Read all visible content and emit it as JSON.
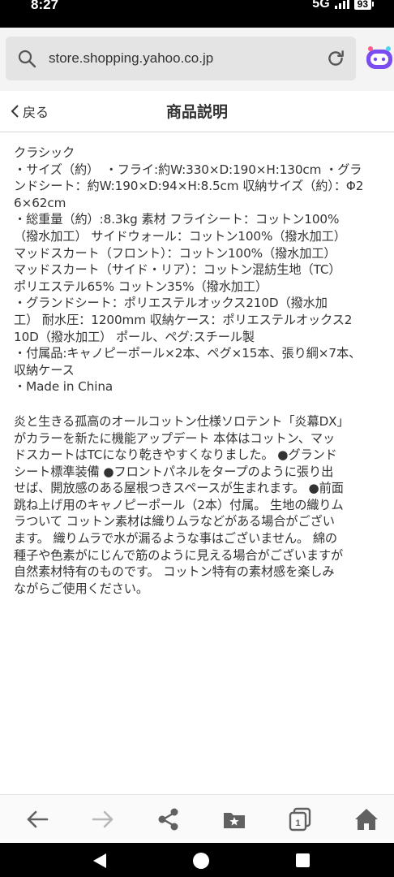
{
  "status_bar": {
    "time": "8:27",
    "network": "5G",
    "battery": "93"
  },
  "browser": {
    "url": "store.shopping.yahoo.co.jp"
  },
  "header": {
    "back_label": "戻る",
    "title": "商品説明"
  },
  "description": {
    "spec_lines": [
      "クラシック",
      "・サイズ（約）　・フライ:約W:330×D:190×H:130cm ・グラ",
      "ンドシート：約W:190×D:94×H:8.5cm 収納サイズ（約）：Φ2",
      "6×62cm",
      "・総重量（約）:8.3kg 素材 フライシート：コットン100%",
      "（撥水加工） サイドウォール：コットン100%（撥水加工）",
      "マッドスカート（フロント）：コットン100%（撥水加工）",
      "マッドスカート（サイド・リア）：コットン混紡生地（TC）",
      "ポリエステル65% コットン35%（撥水加工）",
      "・グランドシート：ポリエステルオックス210D（撥水加",
      "工） 耐水圧：1200mm 収納ケース：ポリエステルオックス2",
      "10D（撥水加工） ポール、ペグ:スチール製",
      "・付属品:キャノピーポール×2本、ペグ×15本、張り綱×7本、",
      "収納ケース",
      "・Made in China"
    ],
    "body_lines": [
      "炎と生きる孤高のオールコットン仕様ソロテント「炎幕DX」",
      "がカラーを新たに機能アップデート 本体はコットン、マッ",
      "ドスカートはTCになり乾きやすくなりました。 ●グランド",
      "シート標準装備 ●フロントパネルをタープのように張り出",
      "せば、開放感のある屋根つきスペースが生まれます。 ●前面",
      "跳ね上げ用のキャノピーポール（2本）付属。 生地の織りム",
      "ラついて コットン素材は織りムラなどがある場合がござい",
      "ます。 織りムラで水が漏るような事はございません。 綿の",
      "種子や色素がにじんで筋のように見える場合がございますが",
      "自然素材特有のものです。 コットン特有の素材感を楽しみ",
      "ながらご使用ください。"
    ]
  },
  "bottom_nav": {
    "tab_count": "1",
    "icons": [
      "back-arrow-icon",
      "forward-arrow-icon",
      "share-icon",
      "bookmark-folder-icon",
      "tabs-icon",
      "home-icon"
    ]
  },
  "colors": {
    "status_bar": "#000000",
    "toolbar_bg": "#f4f4f4",
    "url_box_bg": "#e4e4e4",
    "icon_gray": "#616161",
    "assistant_purple": "#7b4df0",
    "text": "#333333"
  }
}
